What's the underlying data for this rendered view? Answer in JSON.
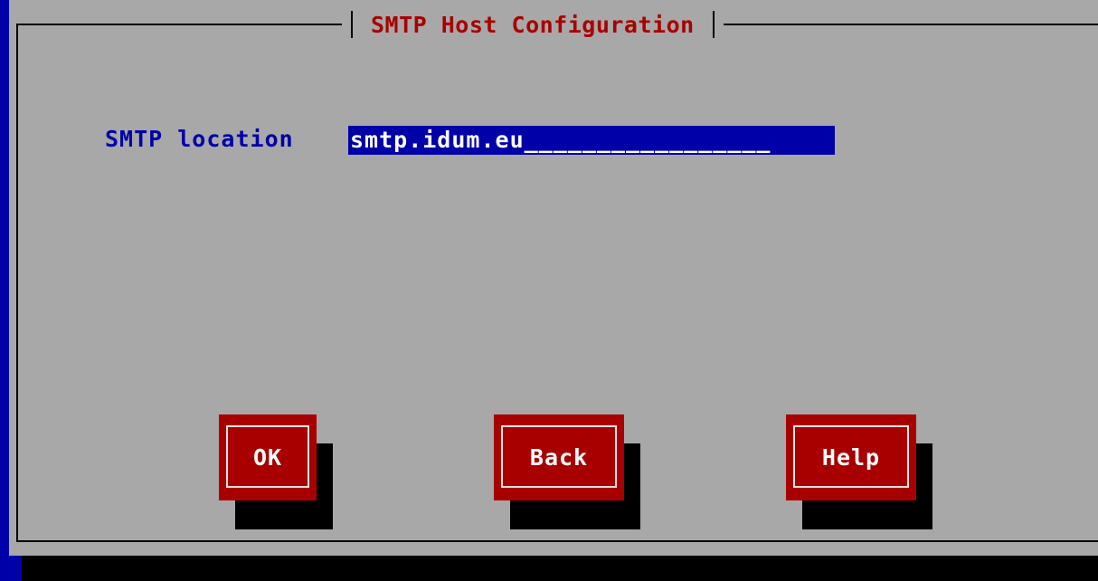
{
  "dialog": {
    "title": "SMTP Host Configuration"
  },
  "form": {
    "smtp_label": "SMTP location",
    "smtp_value": "smtp.idum.eu_________________"
  },
  "buttons": {
    "ok": "OK",
    "back": "Back",
    "help": "Help"
  },
  "colors": {
    "screen_background": "#0000a8",
    "dialog_background": "#a8a8a8",
    "title_text": "#a80000",
    "label_text": "#0000a8",
    "input_background": "#0000a8",
    "button_background": "#a80000",
    "button_text": "#ffffff"
  }
}
